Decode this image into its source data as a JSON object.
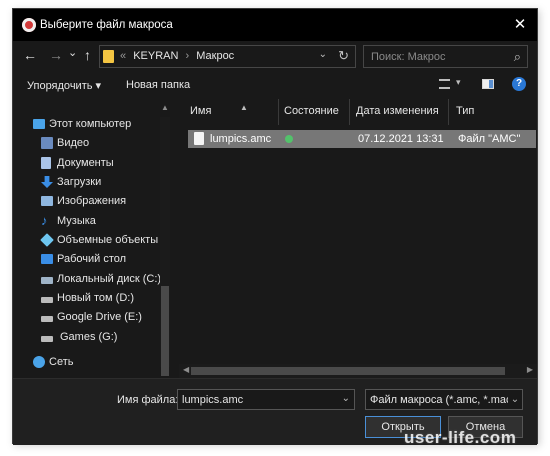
{
  "window": {
    "title": "Выберите файл макроса",
    "close": "✕"
  },
  "address": {
    "back": "←",
    "forward": "→",
    "recent": "⌄",
    "up": "↑",
    "crumb_overflow": "«",
    "crumbs": [
      "KEYRAN",
      "Макрос"
    ],
    "crumb_sep": "›",
    "dropdown": "⌄",
    "refresh": "↻"
  },
  "search": {
    "placeholder": "Поиск: Макрос",
    "icon": "⌕"
  },
  "toolbar": {
    "organize": "Упорядочить ▾",
    "new_folder": "Новая папка",
    "view_dropdown": "▾",
    "help": "?"
  },
  "sidebar": {
    "items": [
      {
        "label": "Этот компьютер",
        "icon": "computer-icon",
        "color": "#4aa3e8"
      },
      {
        "label": "Видео",
        "icon": "video-icon",
        "color": "#6a8bbf"
      },
      {
        "label": "Документы",
        "icon": "documents-icon",
        "color": "#aac4e8"
      },
      {
        "label": "Загрузки",
        "icon": "downloads-icon",
        "color": "#3a8ee6"
      },
      {
        "label": "Изображения",
        "icon": "pictures-icon",
        "color": "#8fb7e0"
      },
      {
        "label": "Музыка",
        "icon": "music-icon",
        "color": "#3a8ee6"
      },
      {
        "label": "Объемные объекты",
        "icon": "3d-objects-icon",
        "color": "#6ec6f0"
      },
      {
        "label": "Рабочий стол",
        "icon": "desktop-icon",
        "color": "#3a8ee6"
      },
      {
        "label": "Локальный диск (C:)",
        "icon": "drive-c-icon",
        "color": "#9fb4c8"
      },
      {
        "label": "Новый том (D:)",
        "icon": "drive-icon",
        "color": "#bbbbbb"
      },
      {
        "label": "Google Drive (E:)",
        "icon": "drive-icon",
        "color": "#bbbbbb"
      },
      {
        "label": "Games (G:)",
        "icon": "drive-icon",
        "color": "#bbbbbb"
      },
      {
        "label": "Сеть",
        "icon": "network-icon",
        "color": "#4aa3e8"
      }
    ]
  },
  "columns": {
    "name": "Имя",
    "status": "Состояние",
    "modified": "Дата изменения",
    "type": "Тип"
  },
  "files": [
    {
      "name": "lumpics.amc",
      "modified": "07.12.2021 13:31",
      "type": "Файл \"AMC\""
    }
  ],
  "footer": {
    "filename_label": "Имя файла:",
    "filename_value": "lumpics.amc",
    "filetype_value": "Файл макроса (*.amc, *.macro)",
    "open": "Открыть",
    "cancel": "Отмена"
  },
  "watermark": "user-life.com"
}
